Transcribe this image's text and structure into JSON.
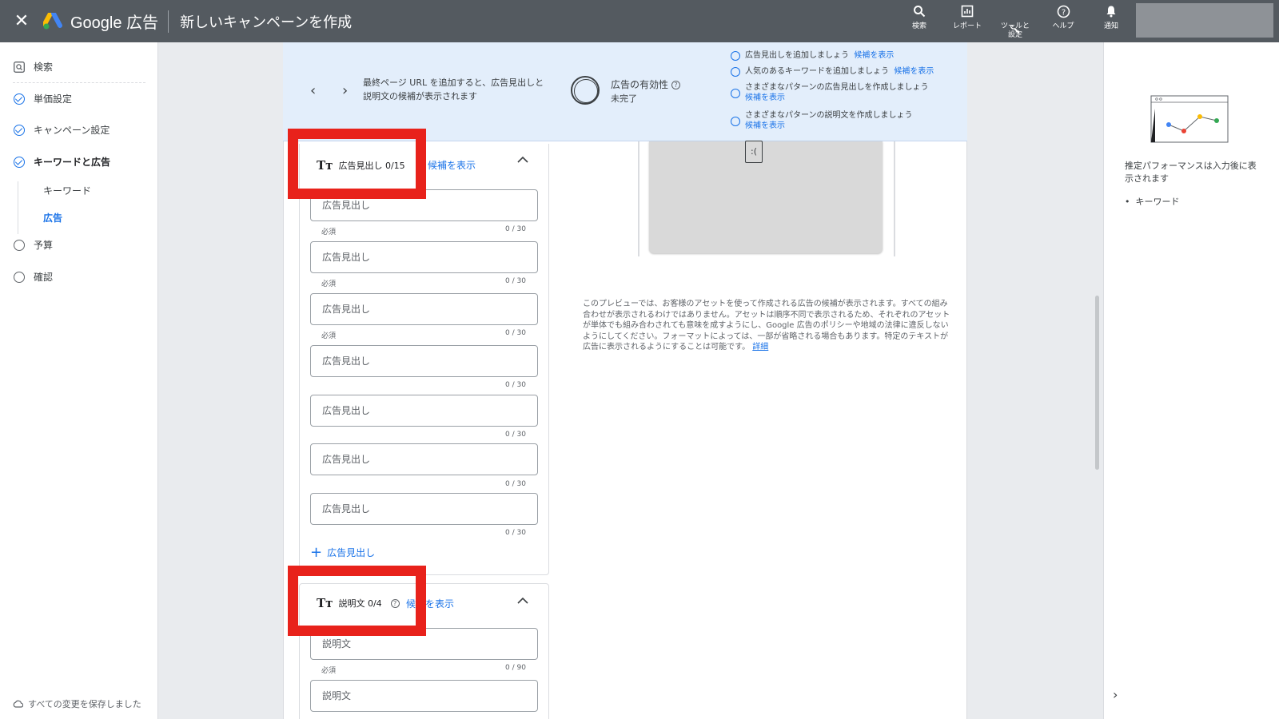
{
  "header": {
    "brand": "Google 広告",
    "title": "新しいキャンペーンを作成",
    "actions": [
      {
        "icon": "search-icon",
        "label": "検索"
      },
      {
        "icon": "report-icon",
        "label": "レポート"
      },
      {
        "icon": "wrench-icon",
        "label": "ツールと\n設定"
      },
      {
        "icon": "help-icon",
        "label": "ヘルプ"
      },
      {
        "icon": "bell-icon",
        "label": "通知"
      }
    ]
  },
  "sidebar": {
    "search": "検索",
    "items": [
      {
        "label": "単価設定",
        "state": "done"
      },
      {
        "label": "キャンペーン設定",
        "state": "done"
      },
      {
        "label": "キーワードと広告",
        "state": "done"
      },
      {
        "label": "予算",
        "state": "todo"
      },
      {
        "label": "確認",
        "state": "todo"
      }
    ],
    "subitems": [
      "キーワード",
      "広告"
    ],
    "saved_status": "すべての変更を保存しました"
  },
  "banner": {
    "message": "最終ページ URL を追加すると、広告見出しと説明文の候補が表示されます",
    "effectiveness_label": "広告の有効性",
    "effectiveness_status": "未完了",
    "suggestions": [
      {
        "text": "広告見出しを追加しましょう",
        "link": "候補を表示"
      },
      {
        "text": "人気のあるキーワードを追加しましょう",
        "link": "候補を表示"
      },
      {
        "text": "さまざまなパターンの広告見出しを作成しましょう",
        "link": "候補を表示"
      },
      {
        "text": "さまざまなパターンの説明文を作成しましょう",
        "link": "候補を表示"
      }
    ]
  },
  "headlines": {
    "title": "広告見出し 0/15",
    "show_suggestions": "候補を表示",
    "placeholder": "広告見出し",
    "required": "必須",
    "counter": "0 / 30",
    "add_label": "広告見出し"
  },
  "descriptions": {
    "title": "説明文 0/4",
    "show_suggestions": "候補を表示",
    "placeholder": "説明文",
    "required": "必須",
    "counter": "0 / 90"
  },
  "preview": {
    "note": "このプレビューでは、お客様のアセットを使って作成される広告の候補が表示されます。すべての組み合わせが表示されるわけではありません。アセットは順序不同で表示されるため、それぞれのアセットが単体でも組み合わされても意味を成すようにし、Google 広告のポリシーや地域の法律に違反しないようにしてください。フォーマットによっては、一部が省略される場合もあります。特定のテキストが広告に表示されるようにすることは可能です。",
    "more_link": "詳細"
  },
  "right_panel": {
    "perf_text": "推定パフォーマンスは入力後に表示されます",
    "bullet": "キーワード"
  },
  "colors": {
    "topbar": "#545a60",
    "accent": "#1a73e8",
    "highlight": "#e8221b",
    "banner": "#e3eefb"
  }
}
